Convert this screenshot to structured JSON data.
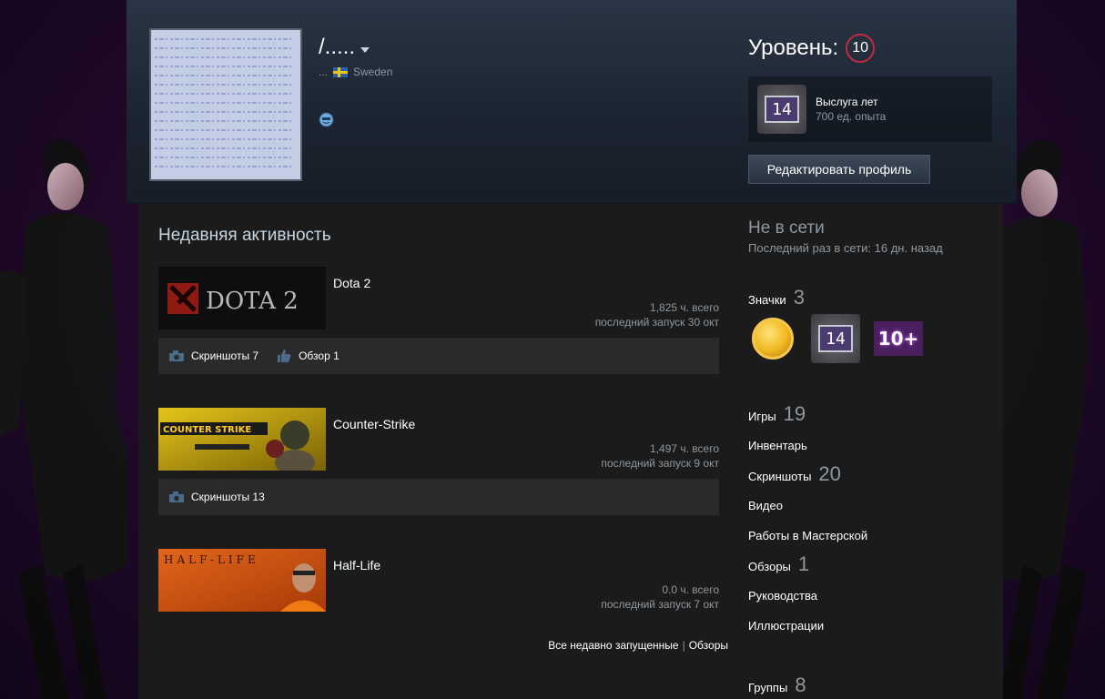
{
  "header": {
    "persona_name": "/.....",
    "location_prefix": "...",
    "country": "Sweden",
    "level_label": "Уровень:",
    "level_value": "10",
    "favorite_badge": {
      "badge_number": "14",
      "title": "Выслуга лет",
      "xp": "700 ед. опыта"
    },
    "edit_button": "Редактировать профиль"
  },
  "activity": {
    "title": "Недавняя активность",
    "games": [
      {
        "name": "Dota 2",
        "hours": "1,825 ч. всего",
        "last_played": "последний запуск 30 окт",
        "capsule_text": "DOTA 2",
        "stats": [
          {
            "icon": "camera-icon",
            "label": "Скриншоты 7"
          },
          {
            "icon": "thumbs-up-icon",
            "label": "Обзор 1"
          }
        ]
      },
      {
        "name": "Counter-Strike",
        "hours": "1,497 ч. всего",
        "last_played": "последний запуск 9 окт",
        "capsule_text": "COUNTER STRIKE",
        "stats": [
          {
            "icon": "camera-icon",
            "label": "Скриншоты 13"
          }
        ]
      },
      {
        "name": "Half-Life",
        "hours": "0.0 ч. всего",
        "last_played": "последний запуск 7 окт",
        "capsule_text": "HALF-LIFE",
        "stats": []
      }
    ],
    "links": {
      "all_recent": "Все недавно запущенные",
      "separator": "|",
      "reviews": "Обзоры"
    }
  },
  "sidebar": {
    "status": "Не в сети",
    "last_online": "Последний раз в сети: 16 дн. назад",
    "badges_label": "Значки",
    "badges_count": "3",
    "badge_tiles": [
      "gold-coin-badge",
      "years-of-service-badge",
      "tenplus-badge"
    ],
    "badge_14": "14",
    "badge_10": "10+",
    "items": [
      {
        "label": "Игры",
        "count": "19"
      },
      {
        "label": "Инвентарь",
        "count": ""
      },
      {
        "label": "Скриншоты",
        "count": "20"
      },
      {
        "label": "Видео",
        "count": ""
      },
      {
        "label": "Работы в Мастерской",
        "count": ""
      },
      {
        "label": "Обзоры",
        "count": "1"
      },
      {
        "label": "Руководства",
        "count": ""
      },
      {
        "label": "Иллюстрации",
        "count": ""
      },
      {
        "label": "Группы",
        "count": "8"
      }
    ]
  },
  "colors": {
    "level_ring": "#c02942",
    "background_purple": "#3a1448",
    "panel": "#1b1b1b"
  }
}
